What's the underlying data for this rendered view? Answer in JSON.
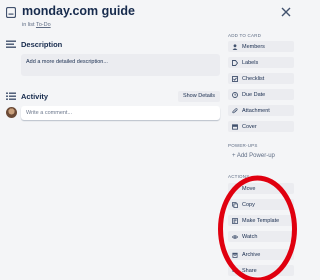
{
  "card": {
    "title": "monday.com guide",
    "in_list_prefix": "in list",
    "list_name": "To-Do"
  },
  "description": {
    "heading": "Description",
    "placeholder": "Add a more detailed description..."
  },
  "activity": {
    "heading": "Activity",
    "show_details_label": "Show Details",
    "comment_placeholder": "Write a comment..."
  },
  "sidebar": {
    "add_to_card_heading": "ADD TO CARD",
    "add_to_card": [
      {
        "label": "Members",
        "icon": "person-icon"
      },
      {
        "label": "Labels",
        "icon": "label-icon"
      },
      {
        "label": "Checklist",
        "icon": "checklist-icon"
      },
      {
        "label": "Due Date",
        "icon": "clock-icon"
      },
      {
        "label": "Attachment",
        "icon": "paperclip-icon"
      },
      {
        "label": "Cover",
        "icon": "cover-icon"
      }
    ],
    "power_ups_heading": "POWER-UPS",
    "add_power_up": "+ Add Power-up",
    "actions_heading": "ACTIONS",
    "actions": [
      {
        "label": "Move",
        "icon": "arrow-right-icon"
      },
      {
        "label": "Copy",
        "icon": "copy-icon"
      },
      {
        "label": "Make Template",
        "icon": "template-icon"
      },
      {
        "label": "Watch",
        "icon": "eye-icon"
      },
      {
        "label": "Archive",
        "icon": "archive-icon"
      },
      {
        "label": "Share",
        "icon": "share-icon"
      }
    ]
  },
  "colors": {
    "background": "#f4f5f7",
    "button": "#ebecf0",
    "text": "#172b4d",
    "muted": "#5e6c84",
    "annotation": "#e0000f"
  }
}
